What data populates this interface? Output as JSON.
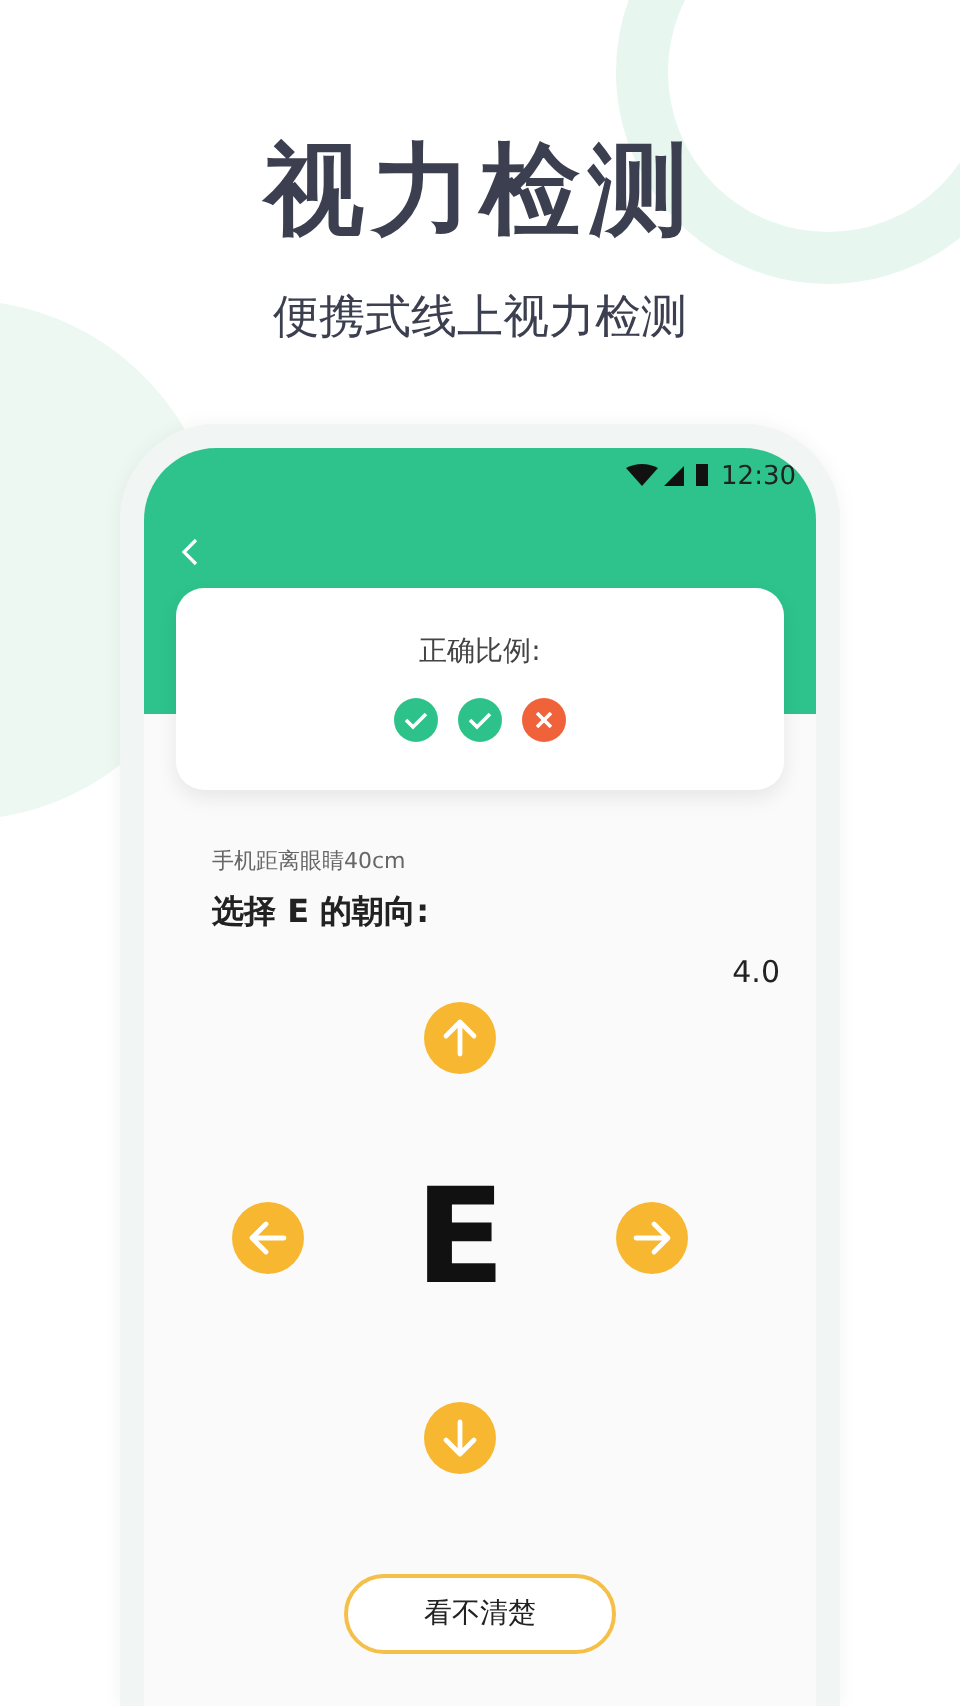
{
  "headline": {
    "title": "视力检测",
    "subtitle": "便携式线上视力检测"
  },
  "status_bar": {
    "time": "12:30"
  },
  "result_card": {
    "label": "正确比例:",
    "results": [
      {
        "correct": true
      },
      {
        "correct": true
      },
      {
        "correct": false
      }
    ]
  },
  "test": {
    "distance_hint": "手机距离眼睛40cm",
    "prompt": "选择 E 的朝向:",
    "acuity": "4.0",
    "optotype": "E",
    "arrows": [
      {
        "kind": "up"
      },
      {
        "kind": "left"
      },
      {
        "kind": "right"
      },
      {
        "kind": "down"
      }
    ]
  },
  "cant_see_button": "看不清楚"
}
